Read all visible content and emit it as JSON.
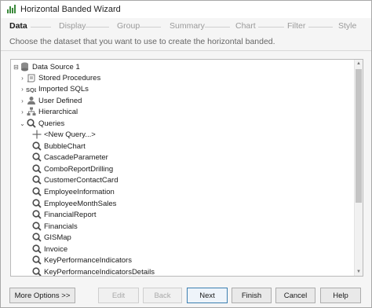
{
  "window": {
    "title": "Horizontal Banded Wizard"
  },
  "steps": [
    "Data",
    "Display",
    "Group",
    "Summary",
    "Chart",
    "Filter",
    "Style"
  ],
  "subtitle": "Choose the dataset that you want to use to create the horizontal banded.",
  "tree": {
    "root": {
      "label": "Data Source 1",
      "expander": "⊟",
      "icon": "database-icon"
    },
    "categories": [
      {
        "label": "Stored Procedures",
        "expander": "›",
        "icon": "scroll-icon"
      },
      {
        "label": "Imported SQLs",
        "expander": "›",
        "icon": "sql-icon"
      },
      {
        "label": "User Defined",
        "expander": "›",
        "icon": "user-icon"
      },
      {
        "label": "Hierarchical",
        "expander": "›",
        "icon": "hierarchy-icon"
      },
      {
        "label": "Queries",
        "expander": "⌄",
        "icon": "query-icon"
      }
    ],
    "queries": [
      "<New Query...>",
      "BubbleChart",
      "CascadeParameter",
      "ComboReportDrilling",
      "CustomerContactCard",
      "EmployeeInformation",
      "EmployeeMonthSales",
      "FinancialReport",
      "Financials",
      "GISMap",
      "Invoice",
      "KeyPerformanceIndicators",
      "KeyPerformanceIndicatorsDetails"
    ]
  },
  "buttons": {
    "more_options": "More Options >>",
    "edit": "Edit",
    "back": "Back",
    "next": "Next",
    "finish": "Finish",
    "cancel": "Cancel",
    "help": "Help"
  },
  "colors": {
    "accent_border": "#3c7fb1",
    "window_bg": "#f5f5f5",
    "query_icon": "#4a4a4a"
  }
}
